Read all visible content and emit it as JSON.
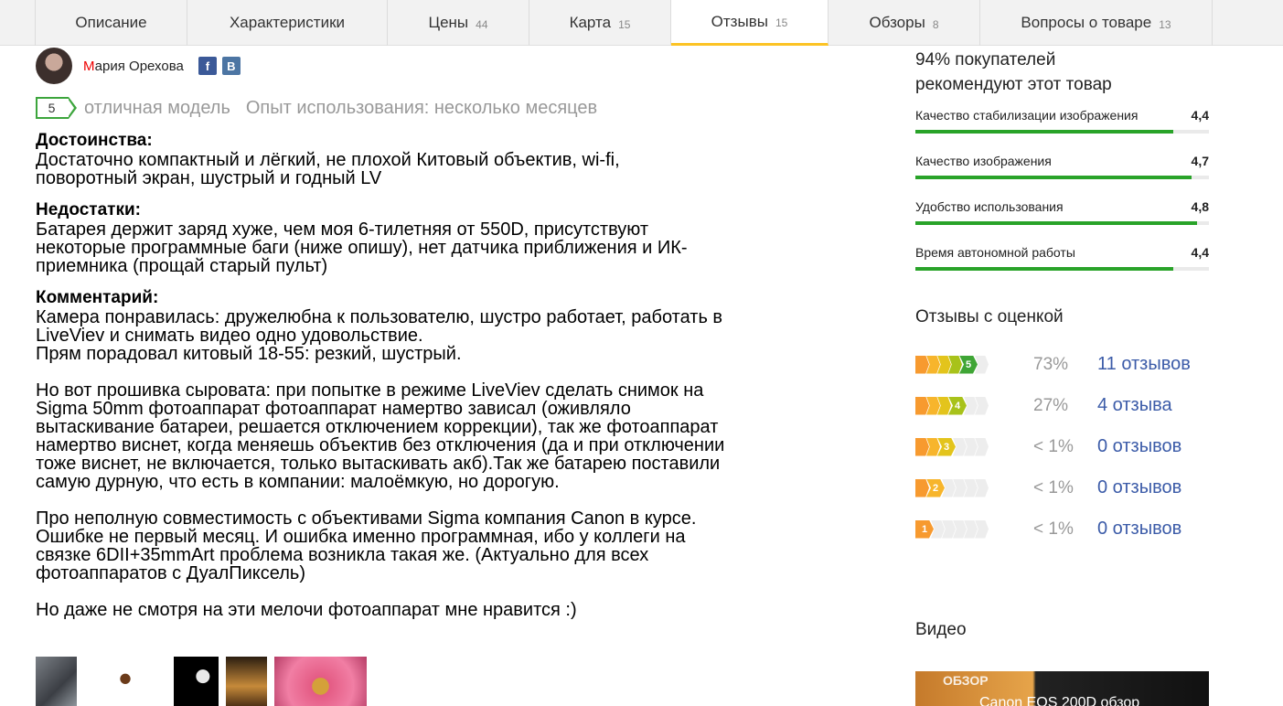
{
  "tabs": [
    {
      "label": "Описание",
      "count": ""
    },
    {
      "label": "Характеристики",
      "count": ""
    },
    {
      "label": "Цены",
      "count": "44"
    },
    {
      "label": "Карта",
      "count": "15"
    },
    {
      "label": "Отзывы",
      "count": "15",
      "active": true
    },
    {
      "label": "Обзоры",
      "count": "8"
    },
    {
      "label": "Вопросы о товаре",
      "count": "13"
    }
  ],
  "review": {
    "author_first": "М",
    "author_rest": "ария Орехова",
    "social": {
      "fb": "f",
      "vk": "B"
    },
    "grade": "5",
    "headline": "отличная модель",
    "usage": "Опыт использования: несколько месяцев",
    "pros_title": "Достоинства:",
    "pros_text": "Достаточно компактный и лёгкий, не плохой Китовый объектив, wi-fi,\nповоротный экран, шустрый и годный LV",
    "cons_title": "Недостатки:",
    "cons_text": "Батарея держит заряд хуже, чем моя 6-тилетняя от 550D, присутствуют\nнекоторые программные баги (ниже опишу), нет датчика приближения и ИК-\nприемника (прощай старый пульт)",
    "comment_title": "Комментарий:",
    "comment_p1": "Камера понравилась: дружелюбна к пользователю, шустро работает, работать в\nLiveViev и снимать видео одно удовольствие.\nПрям порадовал китовый 18-55: резкий, шустрый.",
    "comment_p2": "Но вот прошивка сыровата: при попытке в режиме LiveViev сделать снимок на\nSigma 50mm фотоаппарат фотоаппарат намертво зависал (оживляло\nвытаскивание батареи, решается отключением коррекции), так же фотоаппарат\nнамертво виснет, когда меняешь объектив без отключения (да и при отключении\nтоже виснет, не включается, только вытаскивать акб).Так же батарею поставили\nсамую дурную, что есть в компании: малоёмкую, но дорогую.",
    "comment_p3": "Про неполную совместимость с объективами Sigma компания Canon в курсе.\nОшибке не первый месяц. И ошибка именно программная, ибо у коллеги на\nсвязке 6DII+35mmArt проблема возникла такая же. (Актуально для всех\nфотоаппаратов с ДуалПиксель)",
    "comment_p4": "Но даже не смотря на эти мелочи фотоаппарат мне нравится :)"
  },
  "sidebar": {
    "recommend": "94% покупателей\nрекомендуют этот товар",
    "attributes": [
      {
        "label": "Качество стабилизации изображения",
        "value": "4,4",
        "fraction": 0.88
      },
      {
        "label": "Качество изображения",
        "value": "4,7",
        "fraction": 0.94
      },
      {
        "label": "Удобство использования",
        "value": "4,8",
        "fraction": 0.96
      },
      {
        "label": "Время автономной работы",
        "value": "4,4",
        "fraction": 0.88
      }
    ],
    "rated_title": "Отзывы с оценкой",
    "distribution": [
      {
        "grade": "5",
        "percent": "73%",
        "count": "11 отзывов"
      },
      {
        "grade": "4",
        "percent": "27%",
        "count": "4 отзыва"
      },
      {
        "grade": "3",
        "percent": "< 1%",
        "count": "0 отзывов"
      },
      {
        "grade": "2",
        "percent": "< 1%",
        "count": "0 отзывов"
      },
      {
        "grade": "1",
        "percent": "< 1%",
        "count": "0 отзывов"
      }
    ],
    "video_title": "Видео",
    "video_badge": "ОБЗОР",
    "video_caption": "Canon EOS 200D обзор"
  },
  "colors": {
    "accent_tab": "#fcc324",
    "bar_fill": "#29a329",
    "link": "#3b5ba8",
    "grade_colors": [
      "#f79a2f",
      "#f7b52c",
      "#e3c41c",
      "#a8c21a",
      "#3fa535"
    ]
  }
}
